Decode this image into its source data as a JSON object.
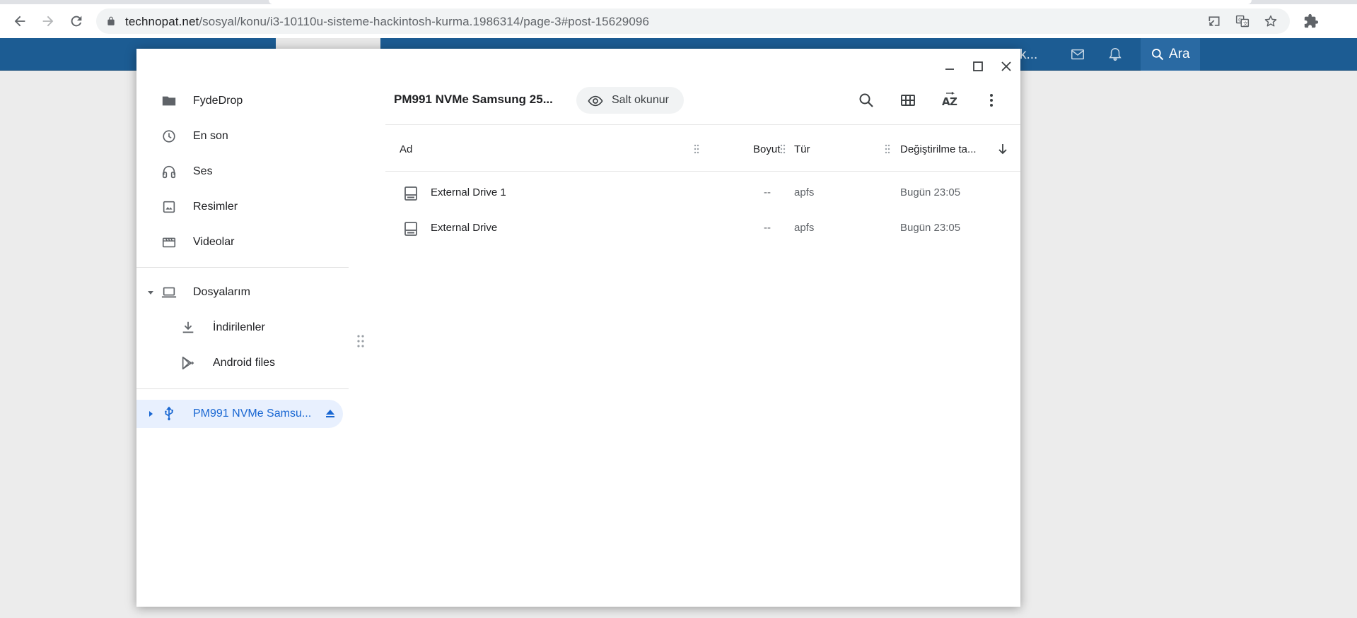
{
  "browser": {
    "url_host": "technopat.net",
    "url_path": "/sosyal/konu/i3-10110u-sisteme-hackintosh-kurma.1986314/page-3#post-15629096",
    "icons": [
      "back-icon",
      "forward-icon",
      "reload-icon",
      "lock-icon",
      "install-icon",
      "translate-icon",
      "star-icon",
      "extensions-icon"
    ]
  },
  "site": {
    "bar_text": "k...",
    "search_label": "Ara",
    "brand_color": "#1c5c93"
  },
  "files_app": {
    "sidebar": {
      "items": [
        {
          "label": "FydeDrop",
          "icon": "folder-icon"
        },
        {
          "label": "En son",
          "icon": "clock-icon"
        },
        {
          "label": "Ses",
          "icon": "headphones-icon"
        },
        {
          "label": "Resimler",
          "icon": "image-icon"
        },
        {
          "label": "Videolar",
          "icon": "video-icon"
        }
      ],
      "my_files": {
        "label": "Dosyalarım",
        "icon": "laptop-icon",
        "expanded": true
      },
      "my_files_children": [
        {
          "label": "İndirilenler",
          "icon": "download-icon"
        },
        {
          "label": "Android files",
          "icon": "play-store-icon"
        }
      ],
      "drive": {
        "label": "PM991 NVMe Samsu...",
        "icon": "usb-icon",
        "active": true
      }
    },
    "toolbar": {
      "breadcrumb": "PM991 NVMe Samsung 25...",
      "readonly_label": "Salt okunur"
    },
    "columns": {
      "name": "Ad",
      "size": "Boyut",
      "type": "Tür",
      "modified": "Değiştirilme ta..."
    },
    "rows": [
      {
        "name": "External Drive 1",
        "size": "--",
        "type": "apfs",
        "modified": "Bugün 23:05"
      },
      {
        "name": "External Drive",
        "size": "--",
        "type": "apfs",
        "modified": "Bugün 23:05"
      }
    ],
    "accent_color": "#1967d2"
  }
}
